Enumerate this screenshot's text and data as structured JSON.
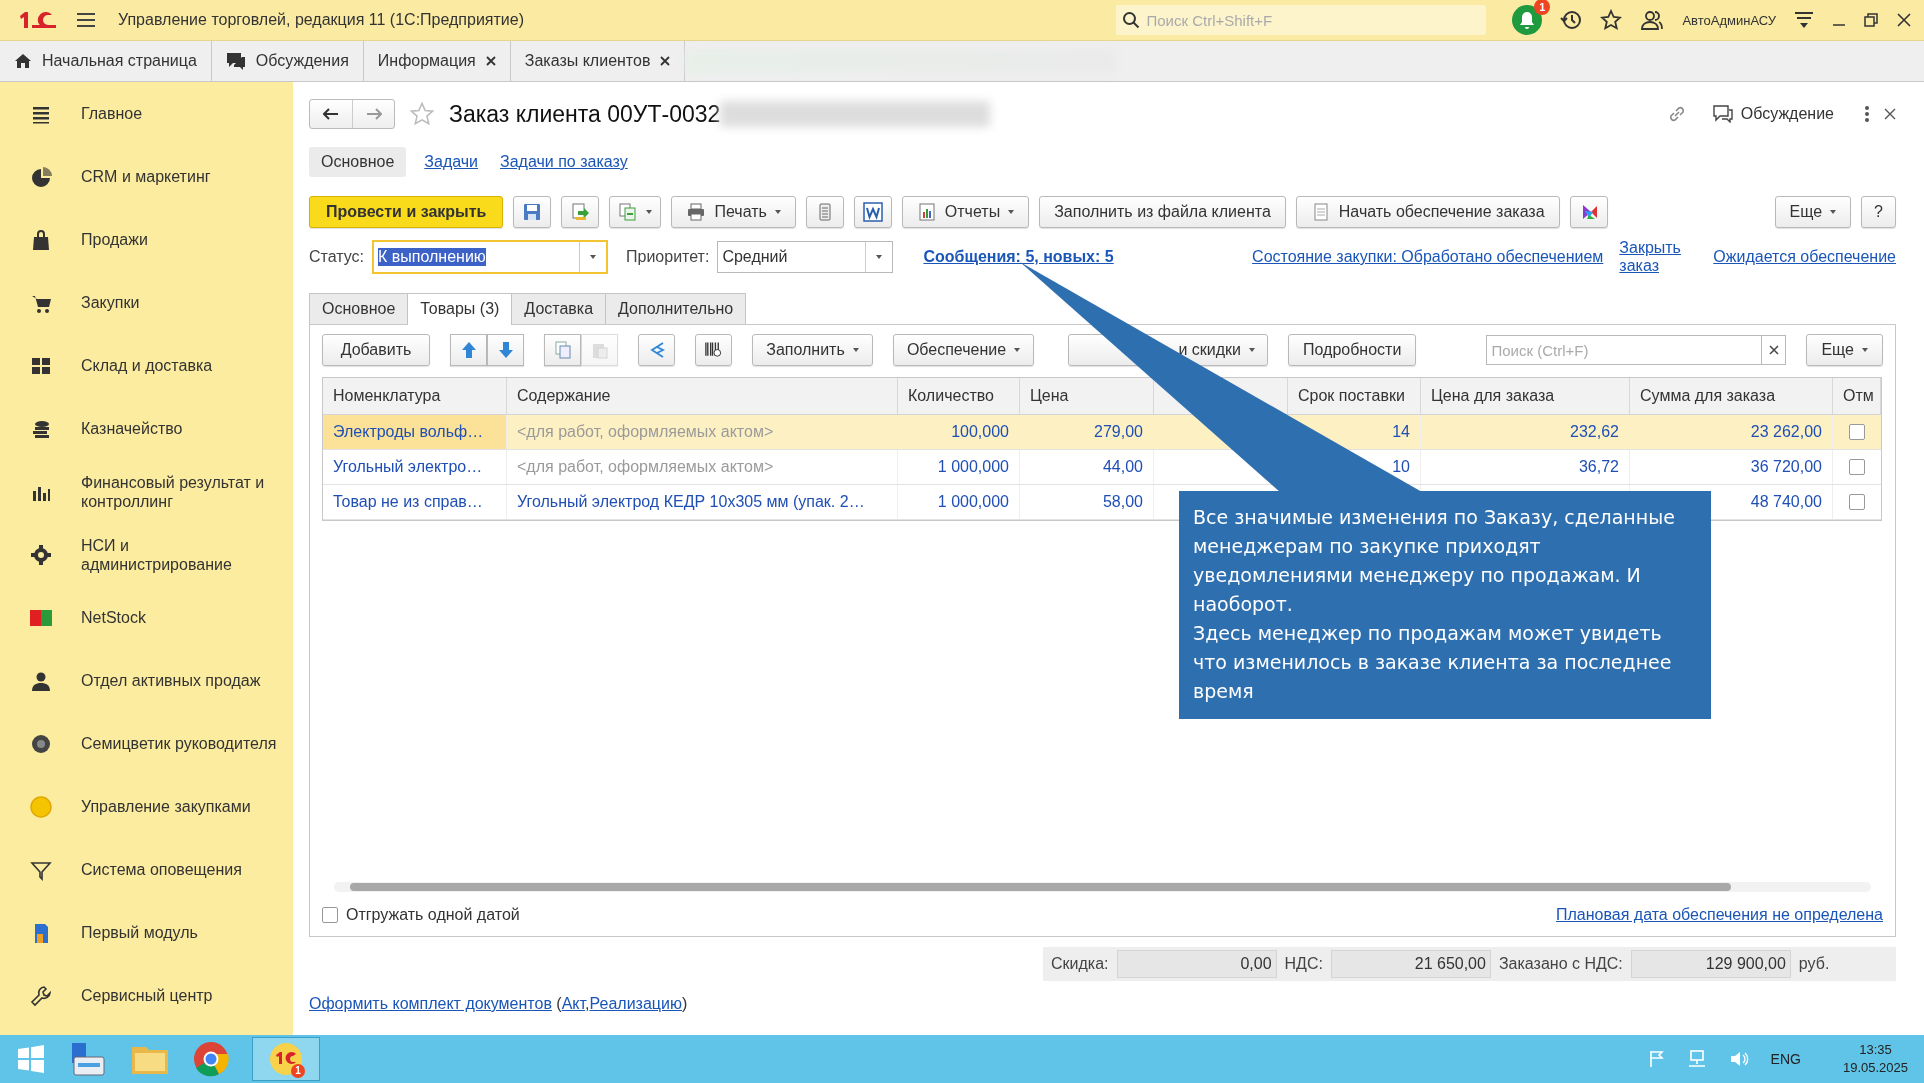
{
  "app_bar": {
    "title": "Управление торговлей, редакция 11  (1С:Предприятие)",
    "search": {
      "placeholder": "Поиск Ctrl+Shift+F"
    },
    "notifications": "1",
    "user": "АвтоАдминАСУ"
  },
  "open_tabs": [
    {
      "label": "Начальная страница",
      "kind": "home",
      "closable": false,
      "selected": false
    },
    {
      "label": "Обсуждения",
      "kind": "chat",
      "closable": false,
      "selected": false
    },
    {
      "label": "Информация",
      "kind": "plain",
      "closable": true,
      "selected": false
    },
    {
      "label": "Заказы клиентов",
      "kind": "plain",
      "closable": true,
      "selected": false
    }
  ],
  "sidebar": {
    "items": [
      {
        "label": "Главное"
      },
      {
        "label": "CRM и маркетинг"
      },
      {
        "label": "Продажи"
      },
      {
        "label": "Закупки"
      },
      {
        "label": "Склад и доставка"
      },
      {
        "label": "Казначейство"
      },
      {
        "label": "Финансовый результат и контроллинг"
      },
      {
        "label": "НСИ и администрирование"
      },
      {
        "label": "NetStock"
      },
      {
        "label": "Отдел активных продаж"
      },
      {
        "label": "Семицветик руководителя"
      },
      {
        "label": "Управление закупками"
      },
      {
        "label": "Система оповещения"
      },
      {
        "label": "Первый модуль"
      },
      {
        "label": "Сервисный центр"
      }
    ]
  },
  "form": {
    "title": "Заказ клиента 00УТ-0032",
    "discussion": "Обсуждение",
    "nav": [
      {
        "label": "Основное",
        "selected": true
      },
      {
        "label": "Задачи",
        "selected": false
      },
      {
        "label": "Задачи по заказу",
        "selected": false
      }
    ],
    "commands": [
      {
        "kind": "primary",
        "label": "Провести и закрыть"
      },
      {
        "kind": "icon"
      },
      {
        "kind": "icon"
      },
      {
        "kind": "icon-menu"
      },
      {
        "kind": "menu",
        "label": "Печать"
      },
      {
        "kind": "icon"
      },
      {
        "kind": "icon"
      },
      {
        "kind": "menu",
        "label": "Отчеты"
      },
      {
        "kind": "text",
        "label": "Заполнить из файла клиента"
      },
      {
        "kind": "text",
        "label": "Начать обеспечение заказа"
      },
      {
        "kind": "icon"
      }
    ],
    "more": "Еще",
    "help": "?",
    "status": {
      "label": "Статус:",
      "value": "К выполнению"
    },
    "priority": {
      "label": "Приоритет:",
      "value": "Средний"
    },
    "messages_link": "Сообщения: 5, новых: 5",
    "links": [
      "Состояние закупки: Обработано обеспечением",
      "Закрыть заказ",
      "Ожидается обеспечение"
    ],
    "tabs": [
      {
        "label": "Основное",
        "selected": false
      },
      {
        "label": "Товары (3)",
        "selected": true
      },
      {
        "label": "Доставка",
        "selected": false
      },
      {
        "label": "Дополнительно",
        "selected": false
      }
    ],
    "table_toolbar": {
      "add": "Добавить",
      "fill": "Заполнить",
      "supply": "Обеспечение",
      "prices_visible_part": "и скидки",
      "details": "Подробности",
      "search": {
        "placeholder": "Поиск (Ctrl+F)"
      },
      "more": "Еще"
    },
    "table": {
      "columns": [
        {
          "label": "Номенклатура"
        },
        {
          "label": "Содержание"
        },
        {
          "label": "Количество"
        },
        {
          "label": "Цена"
        },
        {},
        {
          "label": "Срок поставки"
        },
        {
          "label": "Цена для заказа"
        },
        {
          "label": "Сумма для заказа"
        },
        {
          "label": "Отм"
        }
      ],
      "rows": [
        {
          "selected": true,
          "name": "Электроды вольф…",
          "content": "<для работ, оформляемых актом>",
          "content_placeholder": true,
          "qty": "100,000",
          "price": "279,00",
          "term": "14",
          "order_price": "232,62",
          "order_sum": "23 262,00",
          "checked": false
        },
        {
          "selected": false,
          "name": "Угольный электро…",
          "content": "<для работ, оформляемых актом>",
          "content_placeholder": true,
          "qty": "1 000,000",
          "price": "44,00",
          "term": "10",
          "order_price": "36,72",
          "order_sum": "36 720,00",
          "checked": false
        },
        {
          "selected": false,
          "name": "Товар не из справ…",
          "content": "Угольный электрод КЕДР 10х305 мм (упак. 2…",
          "content_placeholder": false,
          "qty": "1 000,000",
          "price": "58,00",
          "order_sum": "48 740,00",
          "checked": false
        }
      ]
    },
    "ship_one_date": {
      "label": "Отгружать одной датой",
      "checked": false
    },
    "plan_link": "Плановая дата обеспечения не определена",
    "totals": [
      {
        "label": "Скидка:",
        "value": "0,00"
      },
      {
        "label": "НДС:",
        "value": "21 650,00"
      },
      {
        "label": "Заказано с НДС:",
        "value": "129 900,00"
      }
    ],
    "currency": "руб.",
    "documents": {
      "link": "Оформить комплект документов",
      "open": "(",
      "items": [
        "Акт",
        "Реализацию"
      ],
      "separator": ",",
      "close": ")"
    }
  },
  "callout": {
    "paragraphs": [
      "Все значимые изменения по Заказу, сделанные менеджерам по закупке приходят уведомлениями менеджеру по продажам. И наоборот.",
      "Здесь менеджер по продажам может увидеть что изменилось в заказе клиента за последнее время"
    ]
  },
  "taskbar": {
    "badge": "1",
    "language": "ENG",
    "time": "13:35",
    "date": "19.05.2025"
  }
}
